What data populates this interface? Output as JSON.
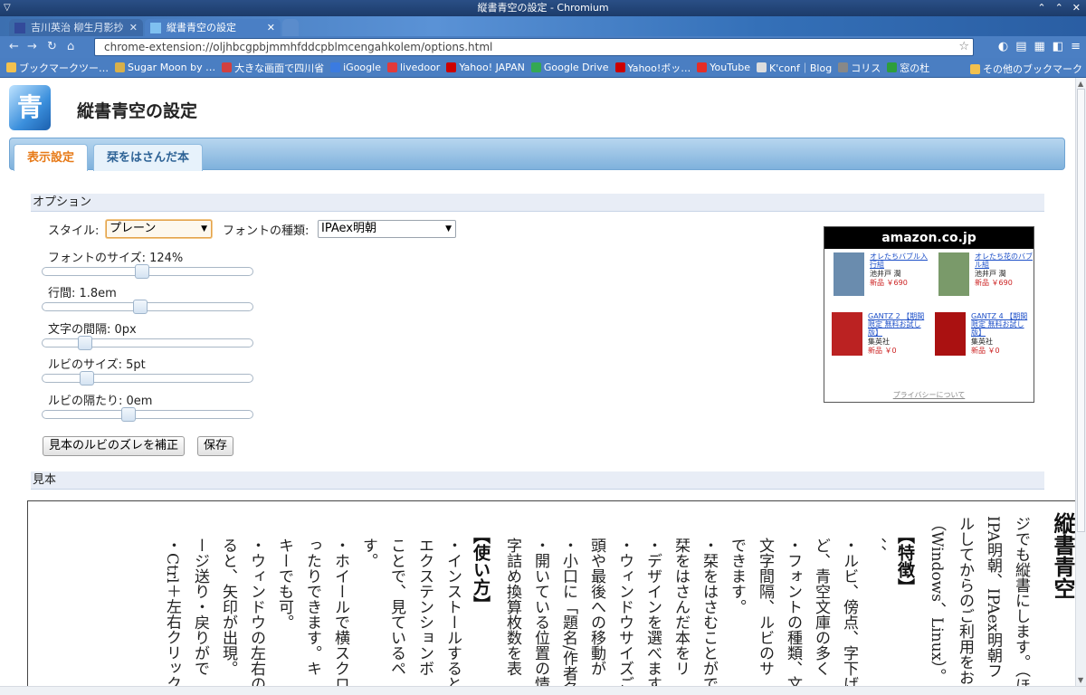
{
  "window": {
    "title": "縦書青空の設定 - Chromium"
  },
  "tabs": [
    {
      "label": "吉川英治 柳生月影抄",
      "active": false
    },
    {
      "label": "縦書青空の設定",
      "active": true
    }
  ],
  "toolbar": {
    "url": "chrome-extension://oljhbcgpbjmmhfddcpblmcengahkolem/options.html"
  },
  "bookmarks": {
    "items": [
      {
        "label": "ブックマークツー…",
        "icon": "folder-icon",
        "color": "#f2c14e"
      },
      {
        "label": "Sugar Moon by …",
        "icon": "globe-icon",
        "color": "#d8b04a"
      },
      {
        "label": "大きな画面で四川省",
        "icon": "image-icon",
        "color": "#d04040"
      },
      {
        "label": "iGoogle",
        "icon": "google-icon",
        "color": "#3b7be0"
      },
      {
        "label": "livedoor",
        "icon": "livedoor-icon",
        "color": "#e23a3a"
      },
      {
        "label": "Yahoo! JAPAN",
        "icon": "yahoo-icon",
        "color": "#c00"
      },
      {
        "label": "Google Drive",
        "icon": "drive-icon",
        "color": "#34a853"
      },
      {
        "label": "Yahoo!ボッ…",
        "icon": "yahoo-icon",
        "color": "#c00"
      },
      {
        "label": "YouTube",
        "icon": "youtube-icon",
        "color": "#e52d27"
      },
      {
        "label": "K'conf｜Blog",
        "icon": "page-icon",
        "color": "#ddd"
      },
      {
        "label": "コリス",
        "icon": "coliss-icon",
        "color": "#888"
      },
      {
        "label": "窓の杜",
        "icon": "madonomori-icon",
        "color": "#2e9e3a"
      }
    ],
    "other_label": "その他のブックマーク"
  },
  "page": {
    "title": "縦書青空の設定",
    "logo_char": "青",
    "tabs": {
      "display": "表示設定",
      "bookmarks": "栞をはさんだ本"
    },
    "options_heading": "オプション",
    "style_label": "スタイル:",
    "style_value": "プレーン",
    "font_label": "フォントの種類:",
    "font_value": "IPAex明朝",
    "sliders": [
      {
        "label": "フォントのサイズ: 124%",
        "value": 0.47
      },
      {
        "label": "行間: 1.8em",
        "value": 0.46
      },
      {
        "label": "文字の間隔: 0px",
        "value": 0.18
      },
      {
        "label": "ルビのサイズ: 5pt",
        "value": 0.19
      },
      {
        "label": "ルビの隔たり: 0em",
        "value": 0.4
      }
    ],
    "fix_ruby_button": "見本のルビのズレを補正",
    "save_button": "保存",
    "sample_heading": "見本"
  },
  "ad": {
    "brand": "amazon.co.jp",
    "items": [
      {
        "title": "オレたちバブル入行組",
        "author": "池井戸 潤",
        "price": "新品 ￥690",
        "cover": "#6a8cae"
      },
      {
        "title": "オレたち花のバブル組",
        "author": "池井戸 潤",
        "price": "新品 ￥690",
        "cover": "#7a9a6a"
      },
      {
        "title": "GANTZ 2 【期間限定 無料お試し版】",
        "author": "集英社",
        "price": "新品 ￥0",
        "cover": "#b22"
      },
      {
        "title": "GANTZ 4 【期間限定 無料お試し版】",
        "author": "集英社",
        "price": "新品 ￥0",
        "cover": "#a11"
      }
    ],
    "privacy": "プライバシーについて"
  },
  "sample": {
    "title": "縦書青空",
    "columns": [
      "ジでも縦書にします。（ほ",
      "IPA明朝、IPAex明朝フ",
      "ルしてからのご利用をお",
      "（Windows、Linux）。"
    ],
    "heading_features": "【特徴】",
    "features": [
      "、、",
      "・ルビ、傍点、字下げ",
      "ど、青空文庫の多く",
      "・フォントの種類、文",
      "文字間隔、ルビのサ",
      "できます。",
      "・栞をはさむことがで",
      "栞をはさんだ本をリ",
      "・デザインを選べます",
      "・ウィンドウサイズご",
      "頭や最後への移動が",
      "・小口に「題名/作者名",
      "・開いている位置の情",
      "字詰め換算枚数を表"
    ],
    "heading_usage": "【使い方】",
    "usage": [
      "・インストールすると",
      "エクステンションボ",
      "ことで、見ているペ",
      "す。",
      "・ホイールで横スクロ",
      "ったりできます。キ",
      "キーでも可。",
      "・ウィンドウの左右の",
      "ると、矢印が出現。",
      "ージ送り・戻りがで",
      "・Ctrl＋左右クリック、"
    ]
  }
}
